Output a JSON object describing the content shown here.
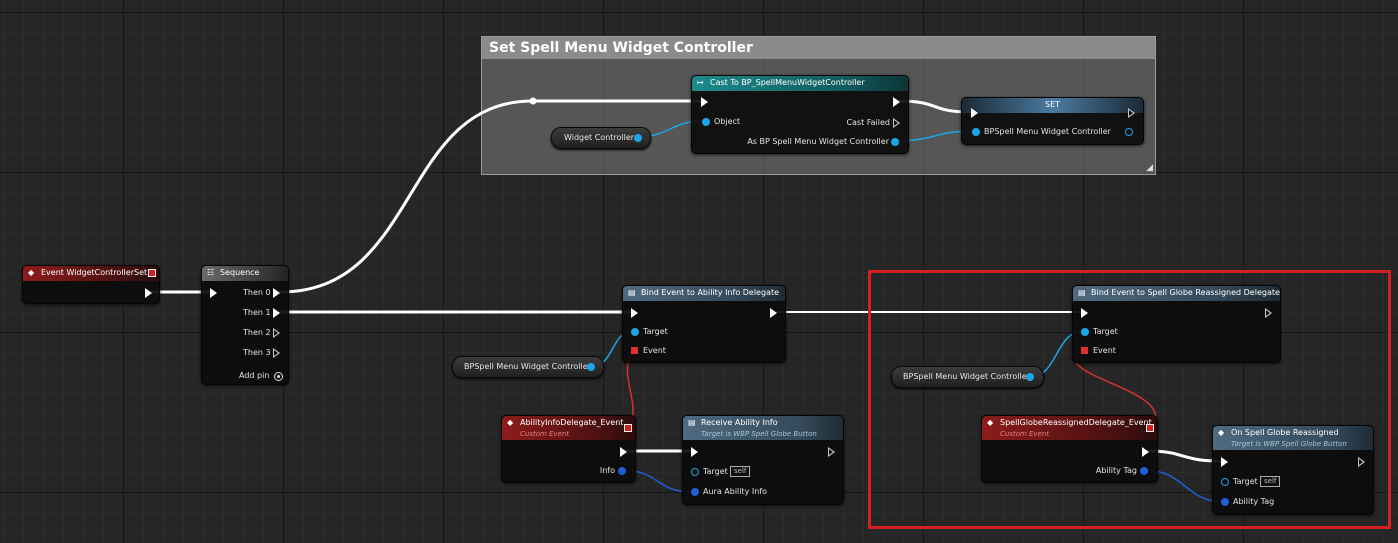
{
  "comment": {
    "title": "Set Spell Menu Widget Controller"
  },
  "nodes": {
    "event": {
      "title": "Event WidgetControllerSet"
    },
    "sequence": {
      "title": "Sequence",
      "pins": [
        "Then 0",
        "Then 1",
        "Then 2",
        "Then 3"
      ],
      "add_pin": "Add pin"
    },
    "cast": {
      "title": "Cast To BP_SpellMenuWidgetController",
      "object": "Object",
      "cast_failed": "Cast Failed",
      "as_output": "As BP Spell Menu Widget Controller"
    },
    "set": {
      "title": "SET",
      "pin": "BPSpell Menu Widget Controller"
    },
    "widget_controller_var": {
      "label": "Widget Controller"
    },
    "bind_ability": {
      "title": "Bind Event to Ability Info Delegate",
      "target": "Target",
      "event": "Event"
    },
    "bpspell_var_1": {
      "label": "BPSpell Menu Widget Controller"
    },
    "ability_delegate_event": {
      "title": "AbilityInfoDelegate_Event",
      "subtitle": "Custom Event",
      "info": "Info"
    },
    "receive_ability": {
      "title": "Receive Ability Info",
      "subtitle": "Target is WBP Spell Globe Button",
      "target": "Target",
      "self": "self",
      "aura": "Aura Ability Info"
    },
    "bind_globe": {
      "title": "Bind Event to Spell Globe Reassigned Delegate",
      "target": "Target",
      "event": "Event"
    },
    "bpspell_var_2": {
      "label": "BPSpell Menu Widget Controller"
    },
    "globe_event": {
      "title": "SpellGlobeReassignedDelegate_Event",
      "subtitle": "Custom Event",
      "ability_tag": "Ability Tag"
    },
    "on_spell_globe": {
      "title": "On Spell Globe Reassigned",
      "subtitle": "Target is WBP Spell Globe Button",
      "target": "Target",
      "self": "self",
      "ability_tag": "Ability Tag"
    }
  },
  "colors": {
    "exec_wire": "#ffffff",
    "object_wire": "#1aa7e8",
    "struct_wire": "#1f5fd6",
    "delegate_wire": "#d63030",
    "highlight": "#d42020"
  }
}
